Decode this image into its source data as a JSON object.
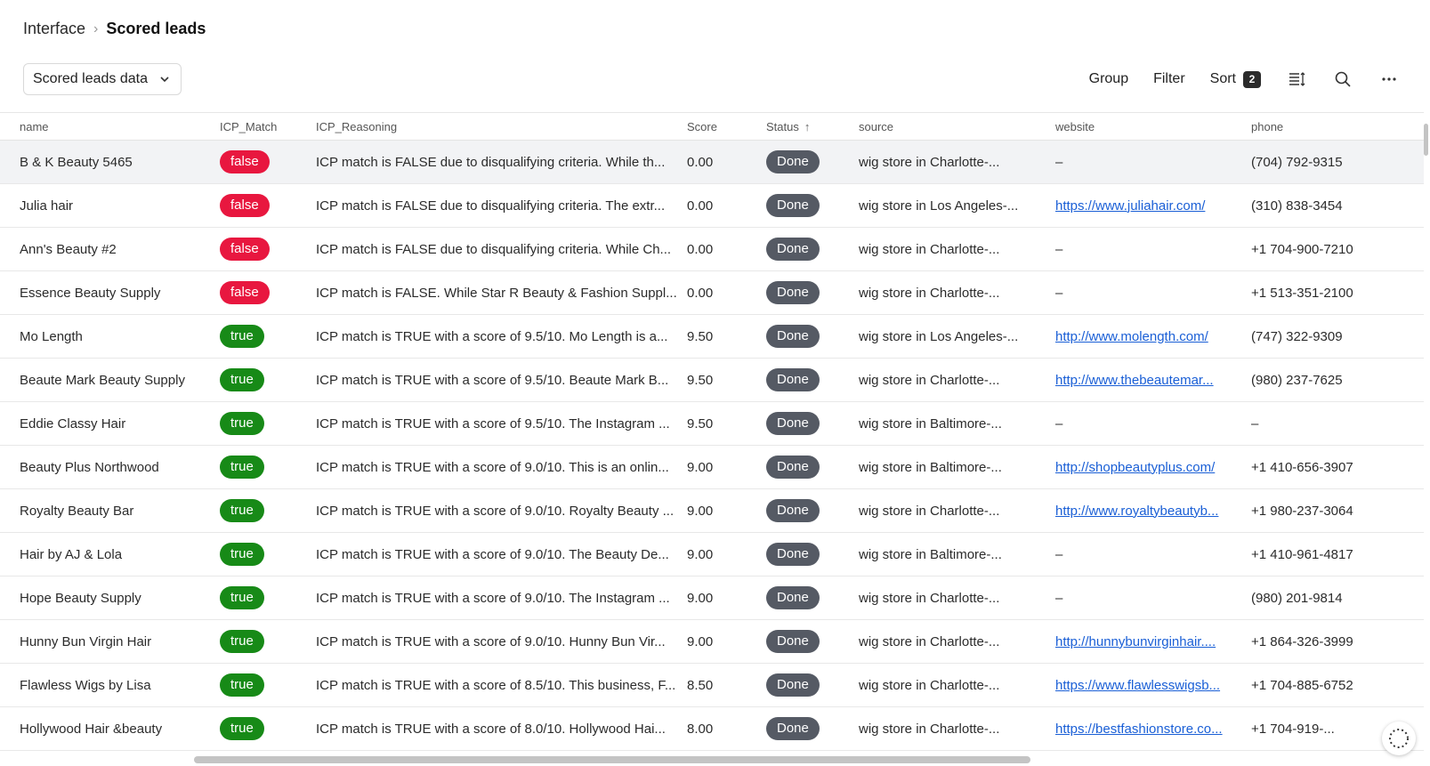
{
  "breadcrumb": {
    "parent": "Interface",
    "current": "Scored leads"
  },
  "view_select": {
    "label": "Scored leads data"
  },
  "toolbar": {
    "group": "Group",
    "filter": "Filter",
    "sort": "Sort",
    "sort_count": "2"
  },
  "columns": {
    "name": "name",
    "icp_match": "ICP_Match",
    "icp_reasoning": "ICP_Reasoning",
    "score": "Score",
    "status": "Status",
    "source": "source",
    "website": "website",
    "phone": "phone"
  },
  "rows": [
    {
      "name": "B & K Beauty 5465",
      "icp": "false",
      "reasoning": "ICP match is FALSE due to disqualifying criteria. While th...",
      "score": "0.00",
      "status": "Done",
      "source": "wig store in Charlotte-...",
      "website": "–",
      "phone": "(704) 792-9315"
    },
    {
      "name": "Julia hair",
      "icp": "false",
      "reasoning": "ICP match is FALSE due to disqualifying criteria. The extr...",
      "score": "0.00",
      "status": "Done",
      "source": "wig store in Los Angeles-...",
      "website": "https://www.juliahair.com/",
      "phone": "(310) 838-3454"
    },
    {
      "name": "Ann's Beauty #2",
      "icp": "false",
      "reasoning": "ICP match is FALSE due to disqualifying criteria. While Ch...",
      "score": "0.00",
      "status": "Done",
      "source": "wig store in Charlotte-...",
      "website": "–",
      "phone": "+1 704-900-7210"
    },
    {
      "name": "Essence Beauty Supply",
      "icp": "false",
      "reasoning": "ICP match is FALSE. While Star R Beauty & Fashion Suppl...",
      "score": "0.00",
      "status": "Done",
      "source": "wig store in Charlotte-...",
      "website": "–",
      "phone": "+1 513-351-2100"
    },
    {
      "name": "Mo Length",
      "icp": "true",
      "reasoning": "ICP match is TRUE with a score of 9.5/10. Mo Length is a...",
      "score": "9.50",
      "status": "Done",
      "source": "wig store in Los Angeles-...",
      "website": "http://www.molength.com/",
      "phone": "(747) 322-9309"
    },
    {
      "name": "Beaute Mark Beauty Supply",
      "icp": "true",
      "reasoning": "ICP match is TRUE with a score of 9.5/10. Beaute Mark B...",
      "score": "9.50",
      "status": "Done",
      "source": "wig store in Charlotte-...",
      "website": "http://www.thebeautemar...",
      "phone": "(980) 237-7625"
    },
    {
      "name": "Eddie Classy Hair",
      "icp": "true",
      "reasoning": "ICP match is TRUE with a score of 9.5/10. The Instagram ...",
      "score": "9.50",
      "status": "Done",
      "source": "wig store in Baltimore-...",
      "website": "–",
      "phone": "–"
    },
    {
      "name": "Beauty Plus Northwood",
      "icp": "true",
      "reasoning": "ICP match is TRUE with a score of 9.0/10. This is an onlin...",
      "score": "9.00",
      "status": "Done",
      "source": "wig store in Baltimore-...",
      "website": "http://shopbeautyplus.com/",
      "phone": "+1 410-656-3907"
    },
    {
      "name": "Royalty Beauty Bar",
      "icp": "true",
      "reasoning": "ICP match is TRUE with a score of 9.0/10. Royalty Beauty ...",
      "score": "9.00",
      "status": "Done",
      "source": "wig store in Charlotte-...",
      "website": "http://www.royaltybeautyb...",
      "phone": "+1 980-237-3064"
    },
    {
      "name": "Hair by AJ & Lola",
      "icp": "true",
      "reasoning": "ICP match is TRUE with a score of 9.0/10. The Beauty De...",
      "score": "9.00",
      "status": "Done",
      "source": "wig store in Baltimore-...",
      "website": "–",
      "phone": "+1 410-961-4817"
    },
    {
      "name": "Hope Beauty Supply",
      "icp": "true",
      "reasoning": "ICP match is TRUE with a score of 9.0/10. The Instagram ...",
      "score": "9.00",
      "status": "Done",
      "source": "wig store in Charlotte-...",
      "website": "–",
      "phone": "(980) 201-9814"
    },
    {
      "name": "Hunny Bun Virgin Hair",
      "icp": "true",
      "reasoning": "ICP match is TRUE with a score of 9.0/10. Hunny Bun Vir...",
      "score": "9.00",
      "status": "Done",
      "source": "wig store in Charlotte-...",
      "website": "http://hunnybunvirginhair....",
      "phone": "+1 864-326-3999"
    },
    {
      "name": "Flawless Wigs by Lisa",
      "icp": "true",
      "reasoning": "ICP match is TRUE with a score of 8.5/10. This business, F...",
      "score": "8.50",
      "status": "Done",
      "source": "wig store in Charlotte-...",
      "website": "https://www.flawlesswigsb...",
      "phone": "+1 704-885-6752"
    },
    {
      "name": "Hollywood Hair &beauty",
      "icp": "true",
      "reasoning": "ICP match is TRUE with a score of 8.0/10. Hollywood Hai...",
      "score": "8.00",
      "status": "Done",
      "source": "wig store in Charlotte-...",
      "website": "https://bestfashionstore.co...",
      "phone": "+1 704-919-..."
    }
  ],
  "colors": {
    "false_pill": "#e8173f",
    "true_pill": "#178a17",
    "done_pill": "#555a64",
    "link": "#1a5fd6"
  }
}
